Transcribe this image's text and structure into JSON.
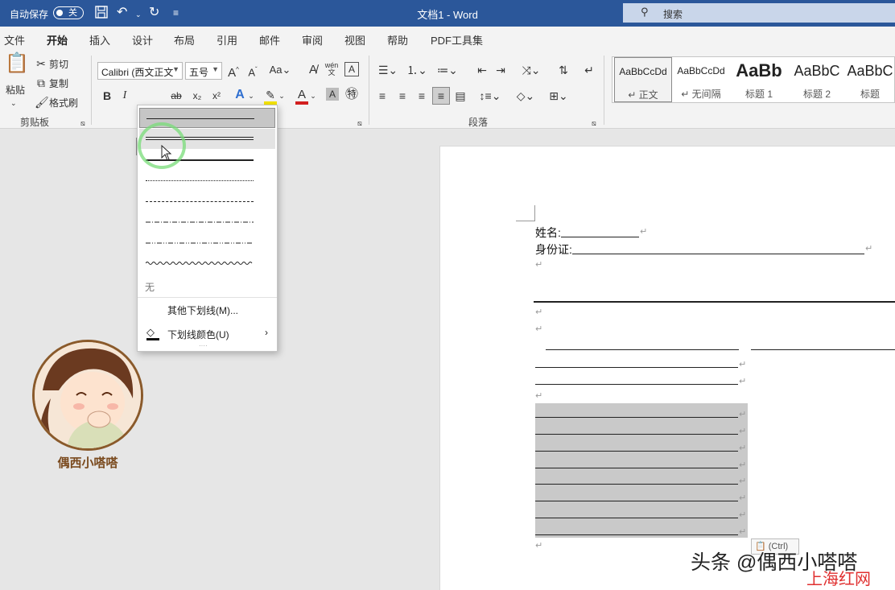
{
  "titlebar": {
    "autosave_label": "自动保存",
    "autosave_state": "关",
    "doc_title": "文档1 - Word",
    "search_placeholder": "搜索"
  },
  "tabs": [
    "文件",
    "开始",
    "插入",
    "设计",
    "布局",
    "引用",
    "邮件",
    "审阅",
    "视图",
    "帮助",
    "PDF工具集"
  ],
  "ribbon": {
    "clipboard": {
      "paste": "粘贴",
      "cut": "剪切",
      "copy": "复制",
      "format_painter": "格式刷",
      "group_label": "剪贴板"
    },
    "font": {
      "font_name": "Calibri (西文正文",
      "font_size": "五号",
      "bold": "B",
      "italic": "I",
      "underline": "U",
      "strike": "ab",
      "subscript": "x₂",
      "superscript": "x²",
      "case": "Aa",
      "grow": "A",
      "shrink": "A"
    },
    "paragraph": {
      "group_label": "段落"
    },
    "styles": [
      {
        "sample": "AaBbCcDd",
        "name": "↵ 正文"
      },
      {
        "sample": "AaBbCcDd",
        "name": "↵ 无间隔"
      },
      {
        "sample": "AaBb",
        "name": "标题 1"
      },
      {
        "sample": "AaBbC",
        "name": "标题 2"
      },
      {
        "sample": "AaBbC",
        "name": "标题"
      }
    ]
  },
  "underline_menu": {
    "none_label": "无",
    "more_underlines": "其他下划线(M)...",
    "underline_color": "下划线颜色(U)"
  },
  "document": {
    "name_label": "姓名:",
    "id_label": "身份证:"
  },
  "paste_tag": "(Ctrl)",
  "avatar_name": "偶西小嗒嗒",
  "watermark": {
    "main": "头条 @偶西小嗒嗒",
    "sub": "上海红网"
  }
}
